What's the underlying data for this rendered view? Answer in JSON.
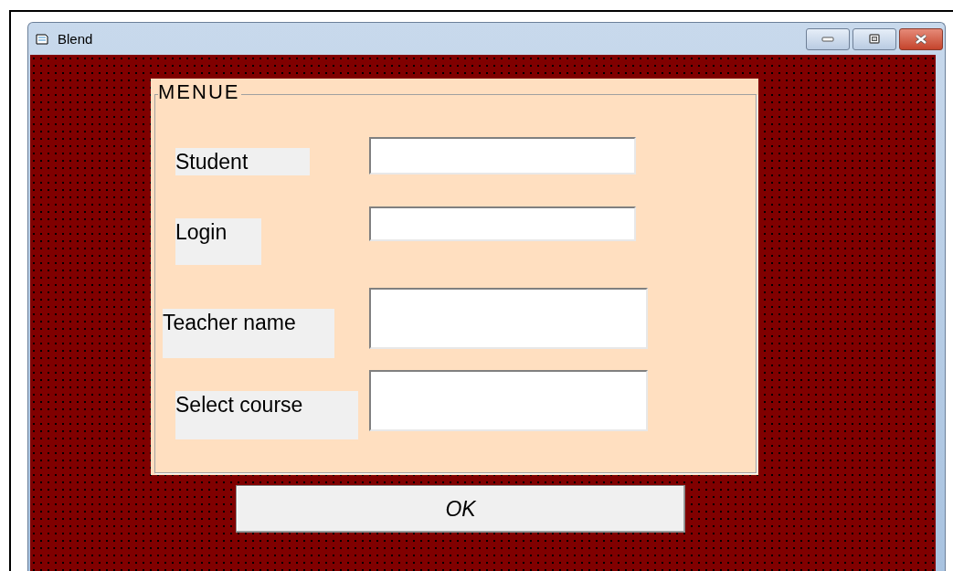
{
  "window": {
    "title": "Blend"
  },
  "frame": {
    "caption": "MENUE",
    "fields": [
      {
        "label": "Student"
      },
      {
        "label": "Login"
      },
      {
        "label": "Teacher name"
      },
      {
        "label": "Select course"
      }
    ]
  },
  "buttons": [
    {
      "label": "OK"
    }
  ]
}
